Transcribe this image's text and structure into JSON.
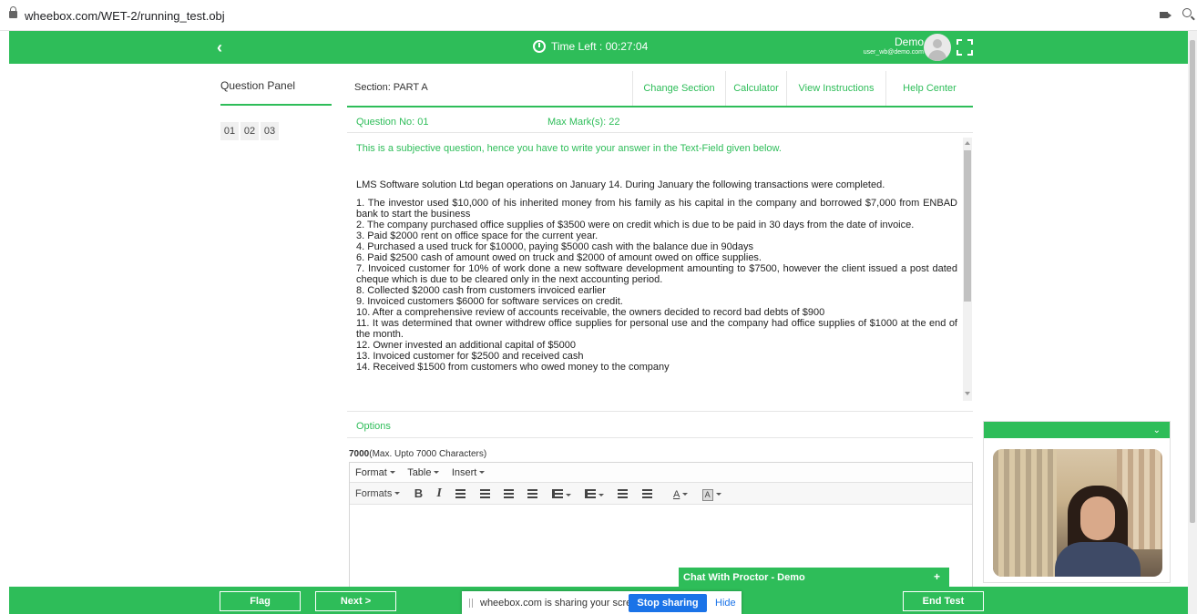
{
  "browser": {
    "url": "wheebox.com/WET-2/running_test.obj"
  },
  "header": {
    "timer_label": "Time Left : 00:27:04",
    "user_name": "Demo",
    "user_email": "user_wb@demo.com",
    "brand_color": "#2ebd59"
  },
  "question_panel": {
    "title": "Question Panel",
    "numbers": [
      "01",
      "02",
      "03"
    ]
  },
  "section": {
    "label": "Section: PART A",
    "buttons": [
      "Change Section",
      "Calculator",
      "View Instructions",
      "Help Center"
    ]
  },
  "question": {
    "number_label": "Question No: 01",
    "max_marks_label": "Max Mark(s): 22",
    "note": "This is a subjective question, hence you have to write your answer in the Text-Field given below.",
    "intro": "LMS Software solution Ltd began operations on January 14. During January the following transactions were completed.",
    "items": [
      "1. The investor used $10,000 of his inherited money from his family as his capital in the company and borrowed $7,000 from ENBAD bank to start the business",
      "2. The company purchased office supplies of $3500 were on credit which is due to be paid in 30 days from the date of invoice.",
      "3. Paid $2000 rent on office space for the current year.",
      "4. Purchased a used truck for $10000, paying $5000 cash with the balance due in 90days",
      "6. Paid $2500 cash of amount owed on truck and $2000 of amount owed on office supplies.",
      "7. Invoiced customer for 10% of work done a new software development amounting to $7500, however the client issued a post dated cheque which is due to be cleared only in the next accounting period.",
      "8. Collected $2000 cash from customers invoiced earlier",
      "9. Invoiced customers $6000 for software services on credit.",
      "10. After a comprehensive review of accounts receivable, the owners decided to record bad debts of $900",
      "11. It was determined that owner withdrew office supplies for personal use and the company had office supplies of $1000 at the end of the month.",
      "12. Owner invested an additional capital of $5000",
      "13. Invoiced customer for $2500 and received cash",
      "14. Received $1500 from customers who owed money to the company"
    ]
  },
  "answer": {
    "options_label": "Options",
    "char_count": "7000",
    "char_limit": "(Max. Upto 7000 Characters)",
    "menus": [
      "Format",
      "Table",
      "Insert"
    ],
    "formats_label": "Formats",
    "bold_label": "B",
    "italic_label": "I",
    "font_color_label": "A",
    "bg_color_label": "A"
  },
  "chat": {
    "label": "Chat With Proctor - Demo",
    "plus": "+"
  },
  "footer": {
    "flag_label": "Flag",
    "next_label": "Next >",
    "end_label": "End Test"
  },
  "share_bar": {
    "message": "wheebox.com is sharing your screen.",
    "stop_label": "Stop sharing",
    "hide_label": "Hide"
  }
}
